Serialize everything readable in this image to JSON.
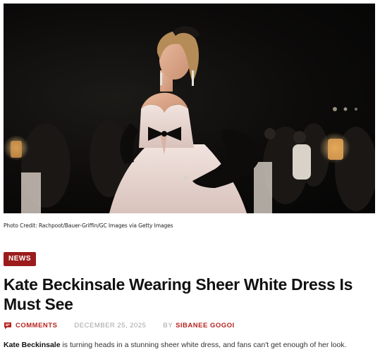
{
  "hero": {
    "icon": "article-photo",
    "caption": "Photo Credit: Rachpoot/Bauer-Griffin/GC Images via Getty Images"
  },
  "article": {
    "category": "NEWS",
    "title": "Kate Beckinsale Wearing Sheer White Dress Is Must See",
    "meta": {
      "comments_label": "COMMENTS",
      "date": "DECEMBER 25, 2025",
      "by_label": "BY",
      "author": "SIBANEE GOGOI"
    },
    "excerpt": {
      "subject": "Kate Beckinsale",
      "text": " is turning heads in a stunning sheer white dress, and fans can't get enough of her look."
    }
  },
  "colors": {
    "accent": "#b5231f",
    "badge_bg": "#9b1c1b",
    "meta_gray": "#a3a3a3"
  }
}
